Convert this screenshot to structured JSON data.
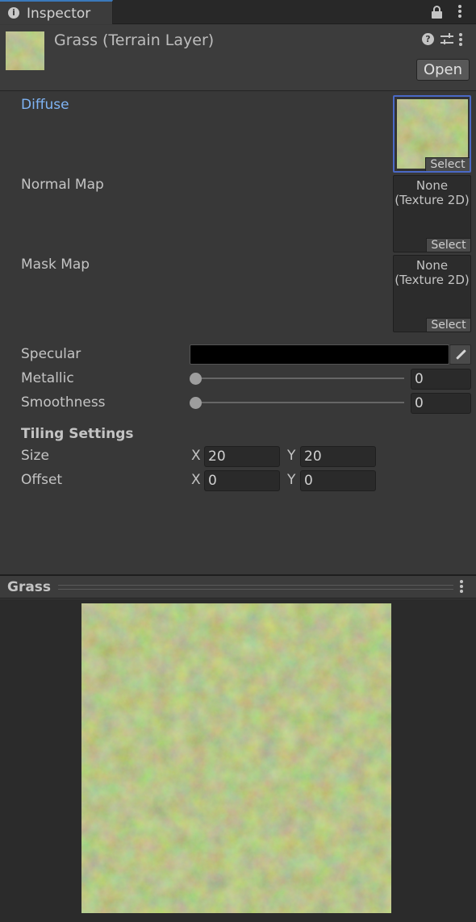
{
  "window": {
    "tab_title": "Inspector",
    "tab_icon": "info-icon"
  },
  "header": {
    "asset_title": "Grass (Terrain Layer)",
    "open_label": "Open"
  },
  "properties": {
    "diffuse": {
      "label": "Diffuse",
      "select_label": "Select"
    },
    "normal_map": {
      "label": "Normal Map",
      "none_line1": "None",
      "none_line2": "(Texture 2D)",
      "select_label": "Select"
    },
    "mask_map": {
      "label": "Mask Map",
      "none_line1": "None",
      "none_line2": "(Texture 2D)",
      "select_label": "Select"
    },
    "specular": {
      "label": "Specular",
      "color": "#000000"
    },
    "metallic": {
      "label": "Metallic",
      "value": "0",
      "level": 0
    },
    "smoothness": {
      "label": "Smoothness",
      "value": "0",
      "level": 0
    }
  },
  "tiling": {
    "heading": "Tiling Settings",
    "size": {
      "label": "Size",
      "x_label": "X",
      "x": "20",
      "y_label": "Y",
      "y": "20"
    },
    "offset": {
      "label": "Offset",
      "x_label": "X",
      "x": "0",
      "y_label": "Y",
      "y": "0"
    }
  },
  "preview": {
    "title": "Grass"
  }
}
